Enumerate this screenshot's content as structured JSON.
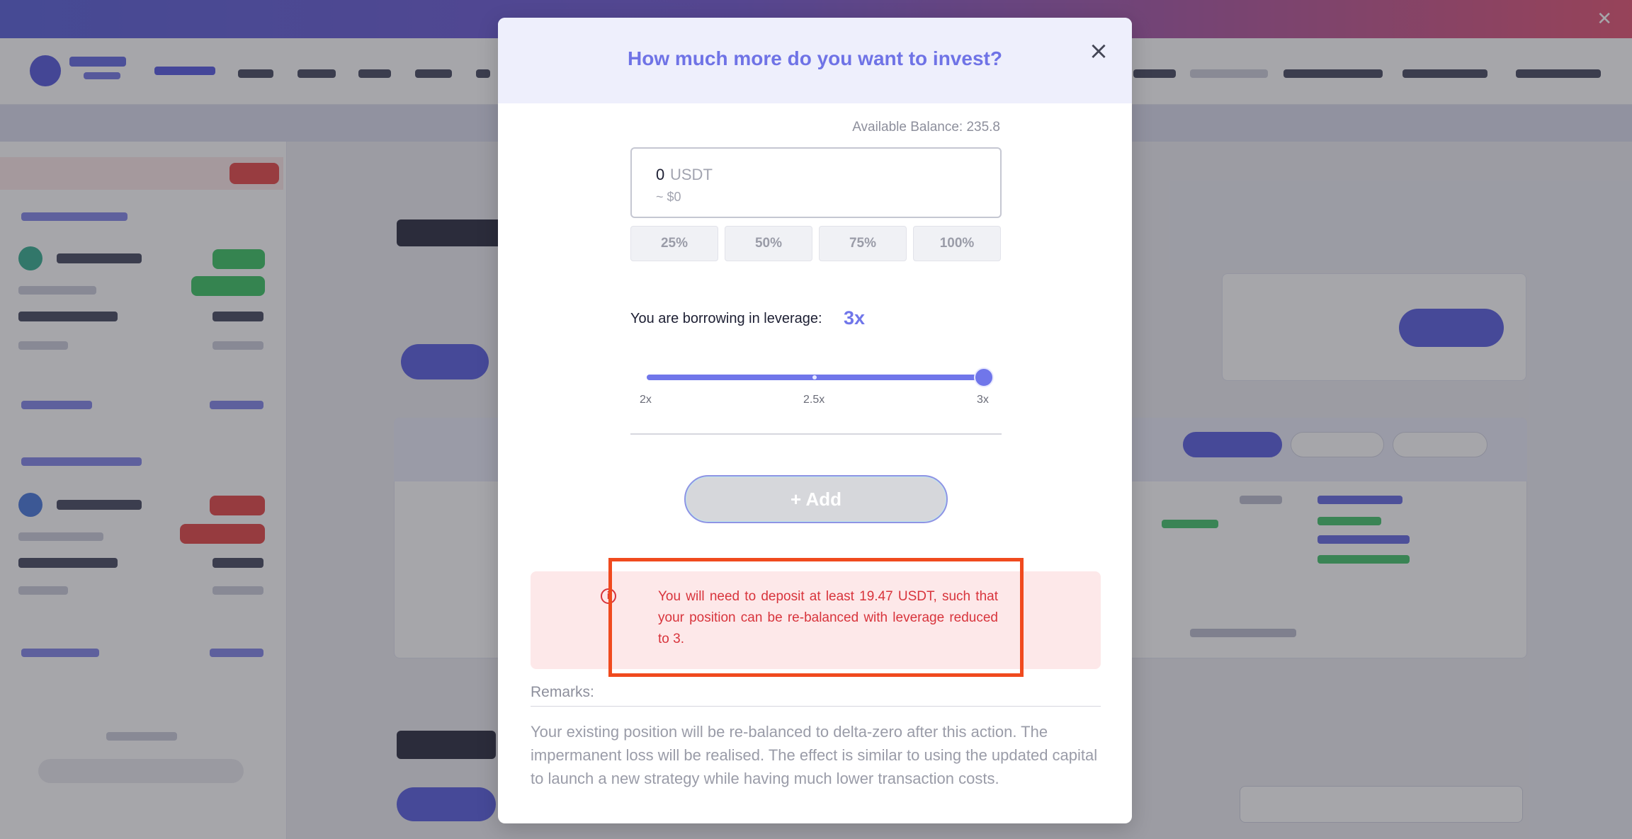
{
  "modal": {
    "title": "How much more do you want to invest?",
    "close_label": "×",
    "available_balance": "Available Balance: 235.8",
    "amount": {
      "value": "0",
      "unit": "USDT",
      "usd_value": "~ $0"
    },
    "percent_options": [
      "25%",
      "50%",
      "75%",
      "100%"
    ],
    "leverage": {
      "label": "You are borrowing in leverage:",
      "value": "3x",
      "level": 1.0,
      "ticks": [
        "2x",
        "2.5x",
        "3x"
      ]
    },
    "add_button": "+ Add",
    "alert": {
      "icon": "info-icon",
      "text": "You will need to deposit at least 19.47 USDT, such that your position can be re-balanced with leverage reduced to 3."
    },
    "remarks": {
      "label": "Remarks:",
      "text": "Your existing position will be re-balanced to delta-zero after this action. The impermanent loss will be realised. The effect is similar to using the updated capital to launch a new strategy while having much lower transaction costs."
    }
  },
  "colors": {
    "accent": "#7076ea",
    "alert_text": "#d8343c",
    "alert_bg": "#fde8e9",
    "highlight": "#f04a1e"
  }
}
